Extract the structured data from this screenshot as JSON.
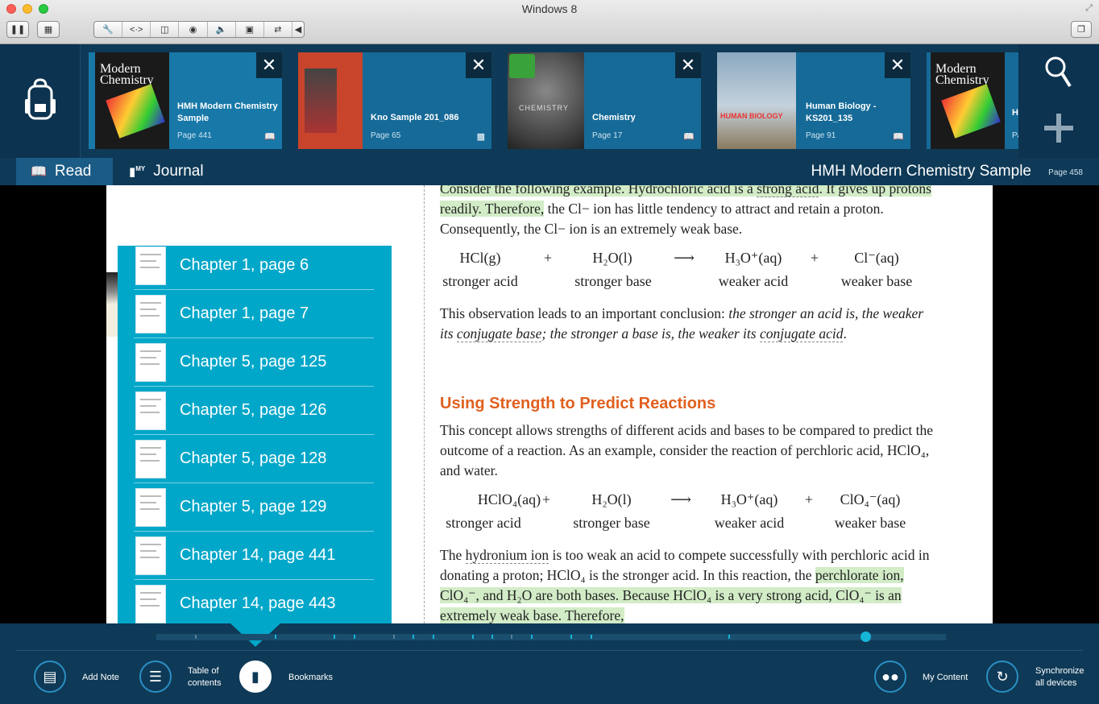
{
  "window": {
    "title": "Windows 8"
  },
  "toolbar": {
    "pause_icon": "pause-icon",
    "screenshot_icon": "screenshot-icon",
    "tools": [
      "wrench-icon",
      "code-icon",
      "disk-icon",
      "lock-icon",
      "speaker-icon",
      "record-icon",
      "sync-icon",
      "arrow-left-icon"
    ]
  },
  "books": [
    {
      "title": "HMH Modern Chemistry Sample",
      "page": "Page 441",
      "cover_text": "Modern Chemistry",
      "cover_color": "#1a1a1a",
      "type_icon": "open-book-icon"
    },
    {
      "title": "Kno Sample 201_086",
      "page": "Page 65",
      "cover_text": "",
      "cover_color": "#c8442a",
      "type_icon": "document-icon"
    },
    {
      "title": "Chemistry",
      "page": "Page 17",
      "cover_text": "CHEMISTRY",
      "cover_color": "#3a3a3a",
      "type_icon": "open-book-icon"
    },
    {
      "title": "Human Biology - KS201_135",
      "page": "Page 91",
      "cover_text": "HUMAN BIOLOGY",
      "cover_color": "#6a8aa0",
      "type_icon": "open-book-icon"
    },
    {
      "title": "H",
      "page": "Pa",
      "cover_text": "Modern Chemistry",
      "cover_color": "#1a1a1a",
      "type_icon": ""
    }
  ],
  "tabs": {
    "read": "Read",
    "journal": "Journal",
    "journal_badge": "MY"
  },
  "current_book": {
    "title": "HMH Modern Chemistry Sample",
    "page": "Page 458"
  },
  "content": {
    "p1a": "Consider the following example. Hydrochloric acid is a ",
    "p1b": "strong acid",
    "p1c": ". It gives up protons readily. Therefore,",
    "p1d": " the Cl− ion has little tendency to attract and retain a proton. Consequently, the Cl− ion is an extremely weak base.",
    "eq1": {
      "a": "HCl(g)",
      "plus1": "+",
      "b": "H₂O(l)",
      "arrow": "⟶",
      "c": "H₃O⁺(aq)",
      "plus2": "+",
      "d": "Cl⁻(aq)"
    },
    "eq1_labels": {
      "a": "stronger acid",
      "b": "stronger base",
      "c": "weaker acid",
      "d": "weaker base"
    },
    "p2a": "This observation leads to an important conclusion: ",
    "p2b": "the stronger an acid is, the weaker its ",
    "p2c": "conjugate base",
    "p2d": "; the stronger a base is, the weaker its ",
    "p2e": "conjugate acid",
    "p2f": ".",
    "heading": "Using Strength to Predict Reactions",
    "p3": "This concept allows strengths of different acids and bases to be compared to predict the outcome of a reaction. As an example, consider the reaction of perchloric acid, HClO₄, and water.",
    "eq2": {
      "a": "HClO₄(aq)",
      "plus1": "+",
      "b": "H₂O(l)",
      "arrow": "⟶",
      "c": "H₃O⁺(aq)",
      "plus2": "+",
      "d": "ClO₄⁻(aq)"
    },
    "eq2_labels": {
      "a": "stronger acid",
      "b": "stronger base",
      "c": "weaker acid",
      "d": "weaker base"
    },
    "p4a": "The ",
    "p4b": "hydronium ion",
    "p4c": " is too weak an acid to compete successfully with perchloric acid in donating a proton; HClO₄ is the stronger acid. In this reaction, the ",
    "p4d": "perchlorate ion, ClO₄⁻, and H₂O are both bases. Because HClO₄ is a very strong acid, ClO₄⁻ is an extremely weak base. Therefore,"
  },
  "toc": [
    "Chapter 1, page 6",
    "Chapter 1, page 7",
    "Chapter 5, page 125",
    "Chapter 5, page 126",
    "Chapter 5, page 128",
    "Chapter 5, page 129",
    "Chapter 14, page 441",
    "Chapter 14, page 443"
  ],
  "bottom": {
    "add_note": "Add Note",
    "toc_line1": "Table of",
    "toc_line2": "contents",
    "bookmarks": "Bookmarks",
    "my_content": "My Content",
    "sync_line1": "Synchronize",
    "sync_line2": "all devices",
    "progress": 0.9
  },
  "colors": {
    "accent": "#00a7c9",
    "bar": "#0e3a57",
    "heading": "#e06020",
    "highlight": "#d2ecc7"
  }
}
